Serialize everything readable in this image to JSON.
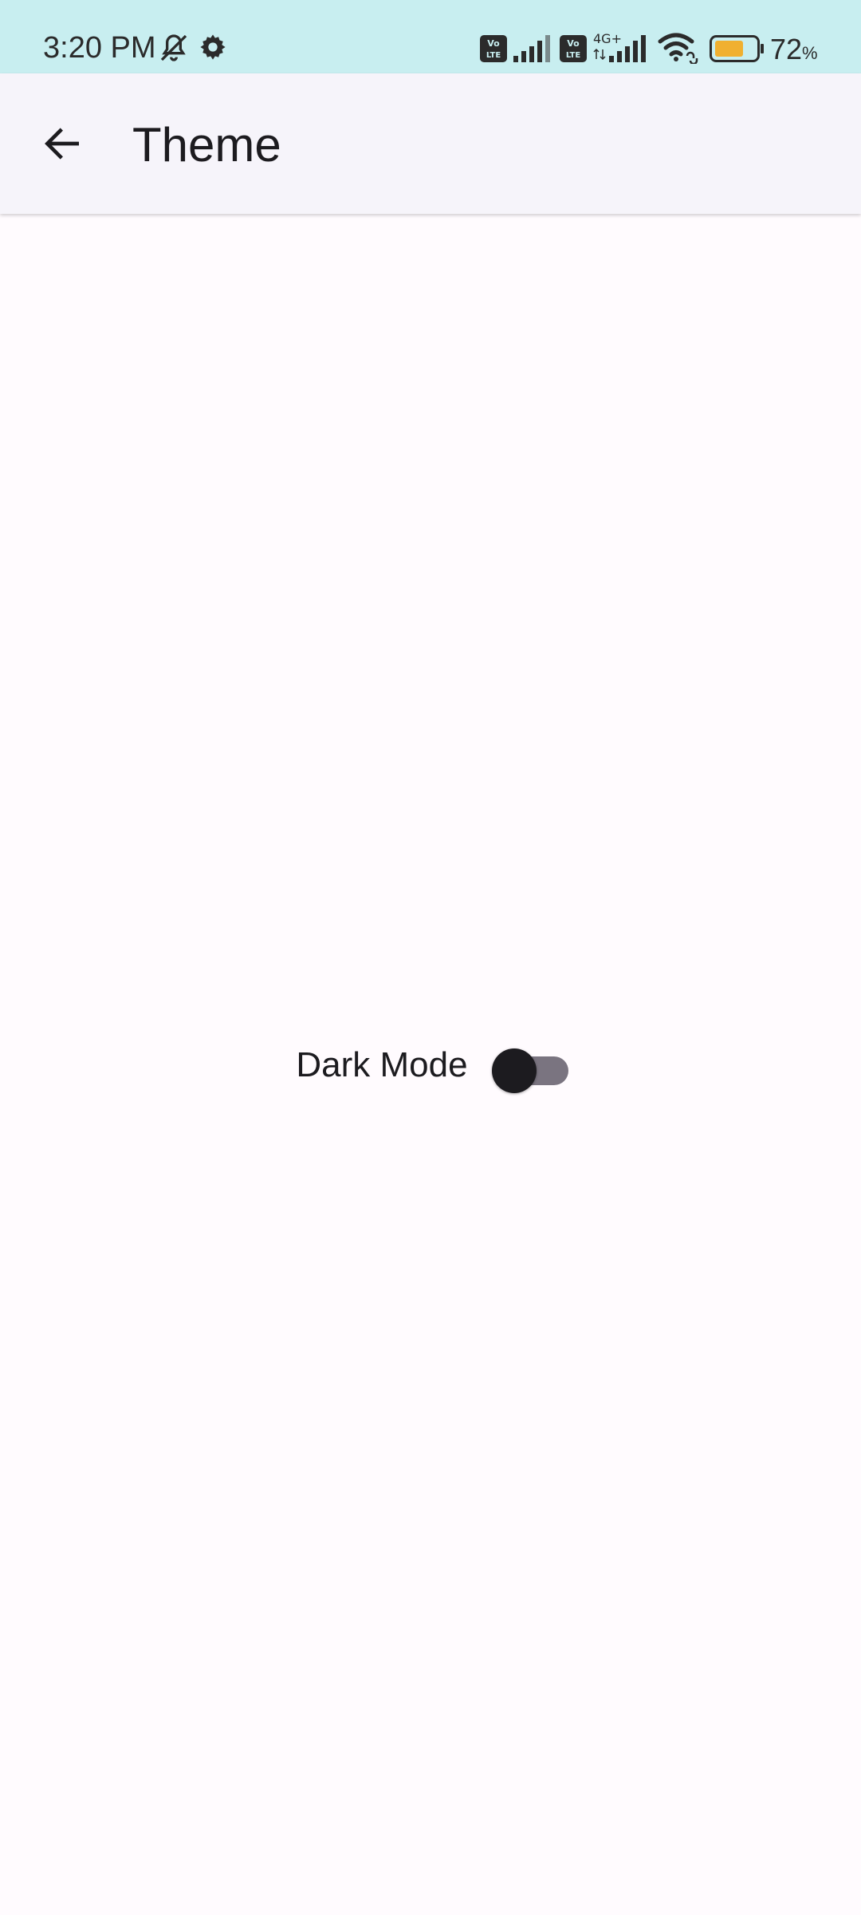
{
  "status_bar": {
    "time": "3:20 PM",
    "battery_percent": "72",
    "battery_unit": "%",
    "icons": [
      "bell-off-icon",
      "gear-icon",
      "volte-icon",
      "signal-icon",
      "volte-icon",
      "4g-plus-icon",
      "signal-icon",
      "wifi-icon",
      "battery-icon"
    ],
    "colors": {
      "background": "#c8eef0",
      "battery_fill": "#f0b030"
    }
  },
  "app_bar": {
    "title": "Theme",
    "back_icon": "arrow-left-icon"
  },
  "settings": {
    "dark_mode": {
      "label": "Dark Mode",
      "enabled": false
    }
  },
  "colors": {
    "page_background": "#fffbfe",
    "app_bar_background": "#f6f4fa",
    "switch_track": "#7a7480",
    "switch_thumb": "#1c1b1f"
  }
}
